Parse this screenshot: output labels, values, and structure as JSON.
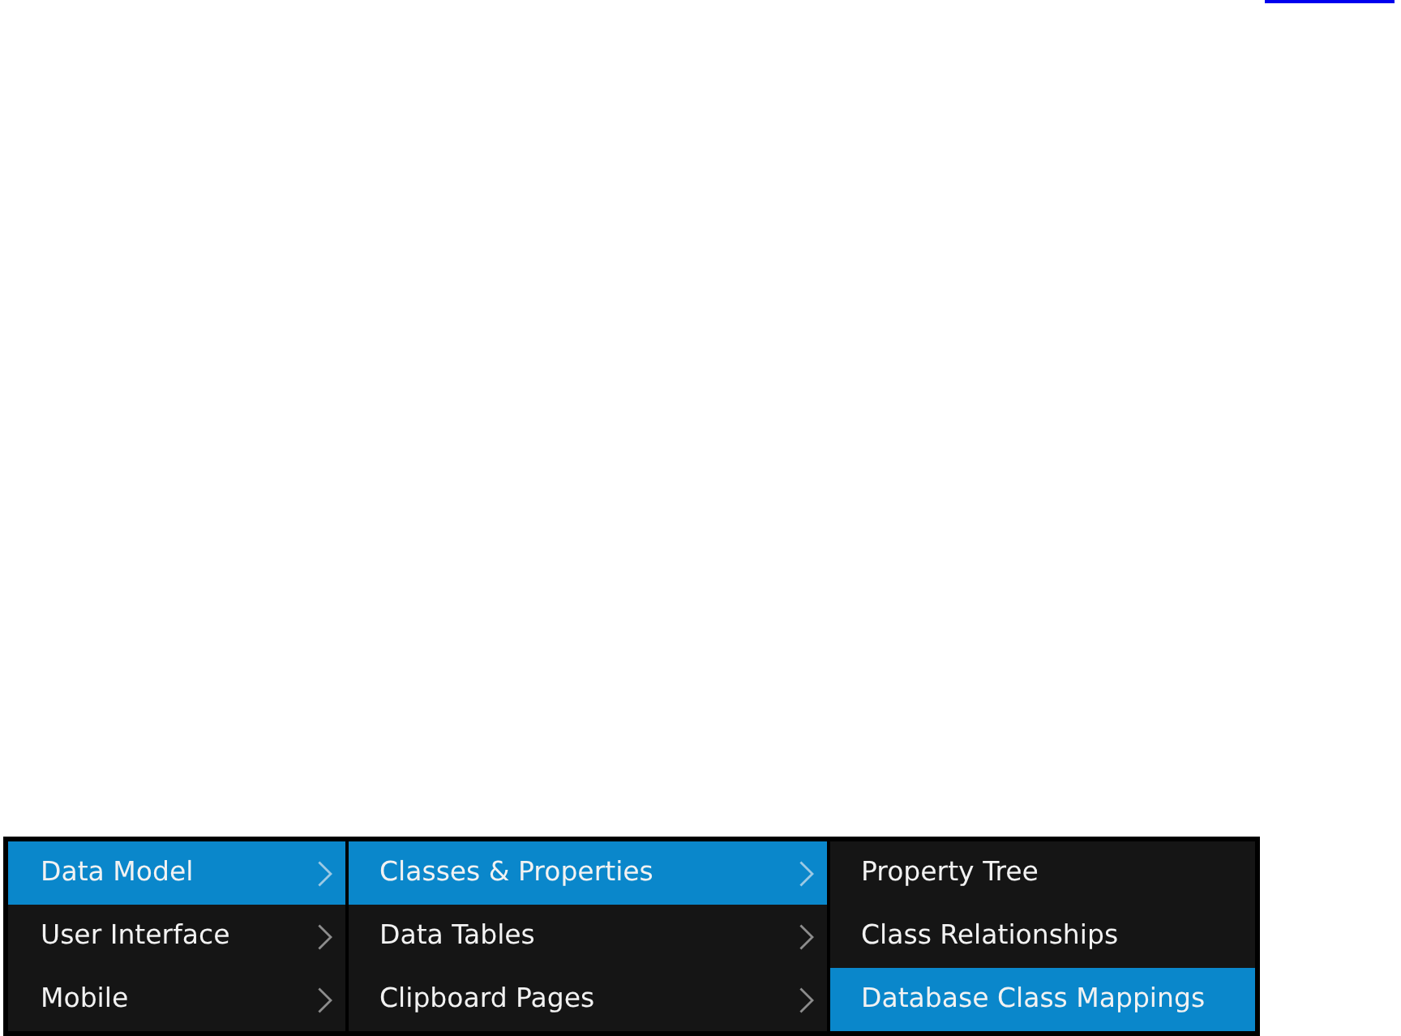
{
  "menu": {
    "columns": [
      {
        "items": [
          {
            "label": "Data Model",
            "selected": true,
            "has_submenu": true
          },
          {
            "label": "User Interface",
            "selected": false,
            "has_submenu": true
          },
          {
            "label": "Mobile",
            "selected": false,
            "has_submenu": true
          }
        ]
      },
      {
        "items": [
          {
            "label": "Classes & Properties",
            "selected": true,
            "has_submenu": true
          },
          {
            "label": "Data Tables",
            "selected": false,
            "has_submenu": true
          },
          {
            "label": "Clipboard Pages",
            "selected": false,
            "has_submenu": true
          }
        ]
      },
      {
        "items": [
          {
            "label": "Property Tree",
            "selected": false,
            "has_submenu": false
          },
          {
            "label": "Class Relationships",
            "selected": false,
            "has_submenu": false
          },
          {
            "label": "Database Class Mappings",
            "selected": true,
            "has_submenu": false
          }
        ]
      }
    ]
  }
}
